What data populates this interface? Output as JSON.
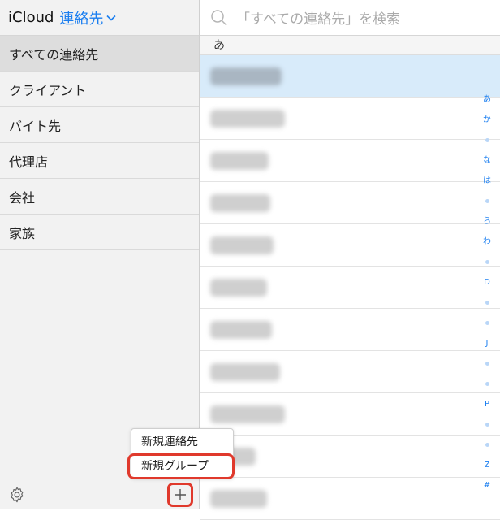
{
  "header": {
    "app_name": "iCloud",
    "section": "連絡先"
  },
  "sidebar": {
    "groups": [
      {
        "label": "すべての連絡先",
        "selected": true
      },
      {
        "label": "クライアント"
      },
      {
        "label": "バイト先"
      },
      {
        "label": "代理店"
      },
      {
        "label": "会社"
      },
      {
        "label": "家族"
      }
    ],
    "footer": {
      "settings_icon": "gear-icon",
      "add_icon": "plus-icon"
    }
  },
  "search": {
    "placeholder": "「すべての連絡先」を検索"
  },
  "contacts": {
    "section_letter": "あ",
    "row_count": 11,
    "selected_index": 0,
    "names_blurred": true
  },
  "index_bar": [
    "あ",
    "か",
    "•",
    "な",
    "は",
    "•",
    "ら",
    "わ",
    "•",
    "D",
    "•",
    "•",
    "J",
    "•",
    "•",
    "P",
    "•",
    "•",
    "Z",
    "#"
  ],
  "add_menu": {
    "items": [
      "新規連絡先",
      "新規グループ"
    ],
    "highlighted": "新規グループ"
  },
  "colors": {
    "accent": "#1a7ef0",
    "highlight": "#e0392c",
    "selected_row": "#d8ebfa"
  }
}
